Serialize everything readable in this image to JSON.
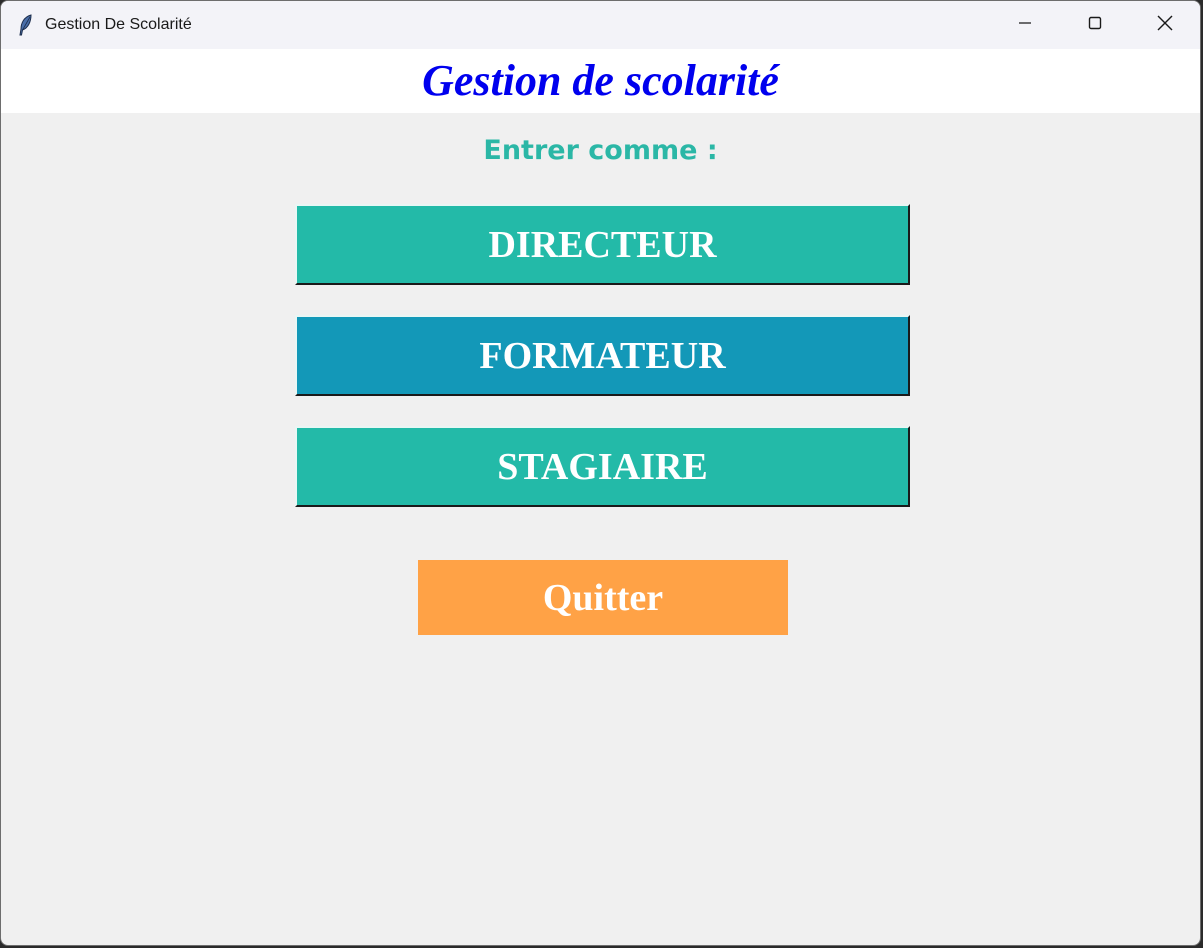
{
  "window": {
    "title": "Gestion De Scolarité",
    "icon": "feather-icon",
    "controls": [
      "minimize-icon",
      "maximize-icon",
      "close-icon"
    ]
  },
  "header": {
    "title": "Gestion de scolarité",
    "title_color": "#0000ee"
  },
  "main": {
    "prompt": "Entrer comme :",
    "prompt_color": "#2bb7a6",
    "roles": [
      {
        "label": "DIRECTEUR",
        "color": "#23baa8"
      },
      {
        "label": "FORMATEUR",
        "color": "#1398b8"
      },
      {
        "label": "STAGIAIRE",
        "color": "#23baa8"
      }
    ],
    "quit_label": "Quitter",
    "quit_color": "#ffa246"
  }
}
